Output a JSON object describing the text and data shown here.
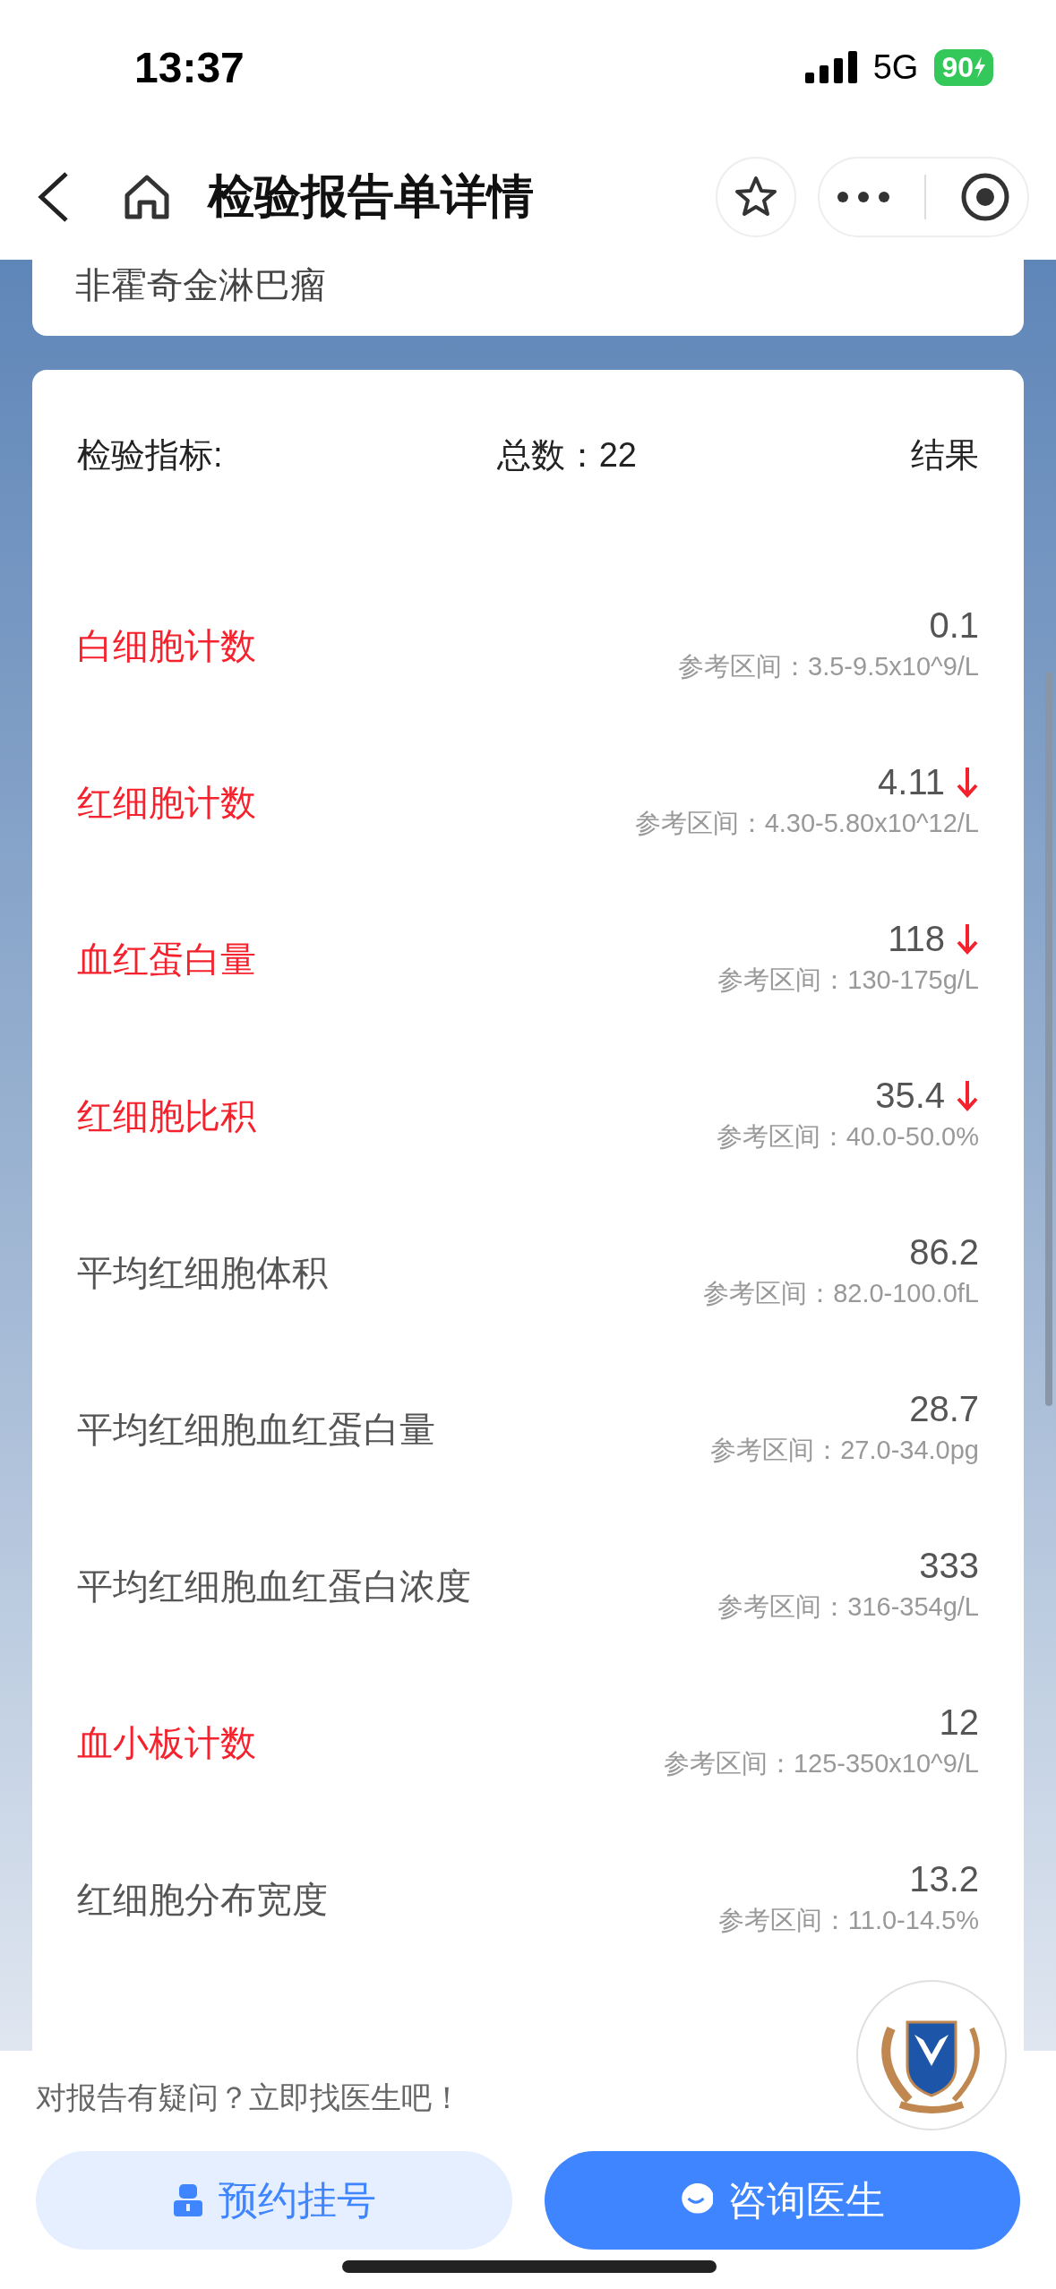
{
  "status_bar": {
    "time": "13:37",
    "network": "5G",
    "battery": "90"
  },
  "nav": {
    "title": "检验报告单详情"
  },
  "prev_card": {
    "text": "非霍奇金淋巴瘤"
  },
  "report": {
    "header": {
      "label": "检验指标:",
      "total": "总数：22",
      "result": "结果"
    },
    "items": [
      {
        "name": "白细胞计数",
        "value": "0.1",
        "reference": "参考区间：3.5-9.5x10^9/L",
        "abnormal": true,
        "low_arrow": false
      },
      {
        "name": "红细胞计数",
        "value": "4.11",
        "reference": "参考区间：4.30-5.80x10^12/L",
        "abnormal": true,
        "low_arrow": true
      },
      {
        "name": "血红蛋白量",
        "value": "118",
        "reference": "参考区间：130-175g/L",
        "abnormal": true,
        "low_arrow": true
      },
      {
        "name": "红细胞比积",
        "value": "35.4",
        "reference": "参考区间：40.0-50.0%",
        "abnormal": true,
        "low_arrow": true
      },
      {
        "name": "平均红细胞体积",
        "value": "86.2",
        "reference": "参考区间：82.0-100.0fL",
        "abnormal": false,
        "low_arrow": false
      },
      {
        "name": "平均红细胞血红蛋白量",
        "value": "28.7",
        "reference": "参考区间：27.0-34.0pg",
        "abnormal": false,
        "low_arrow": false
      },
      {
        "name": "平均红细胞血红蛋白浓度",
        "value": "333",
        "reference": "参考区间：316-354g/L",
        "abnormal": false,
        "low_arrow": false
      },
      {
        "name": "血小板计数",
        "value": "12",
        "reference": "参考区间：125-350x10^9/L",
        "abnormal": true,
        "low_arrow": false
      },
      {
        "name": "红细胞分布宽度",
        "value": "13.2",
        "reference": "参考区间：11.0-14.5%",
        "abnormal": false,
        "low_arrow": false
      }
    ]
  },
  "footer": {
    "prompt": "对报告有疑问？立即找医生吧！",
    "buttons": [
      {
        "label": "预约挂号",
        "kind": "secondary"
      },
      {
        "label": "咨询医生",
        "kind": "primary"
      }
    ]
  }
}
